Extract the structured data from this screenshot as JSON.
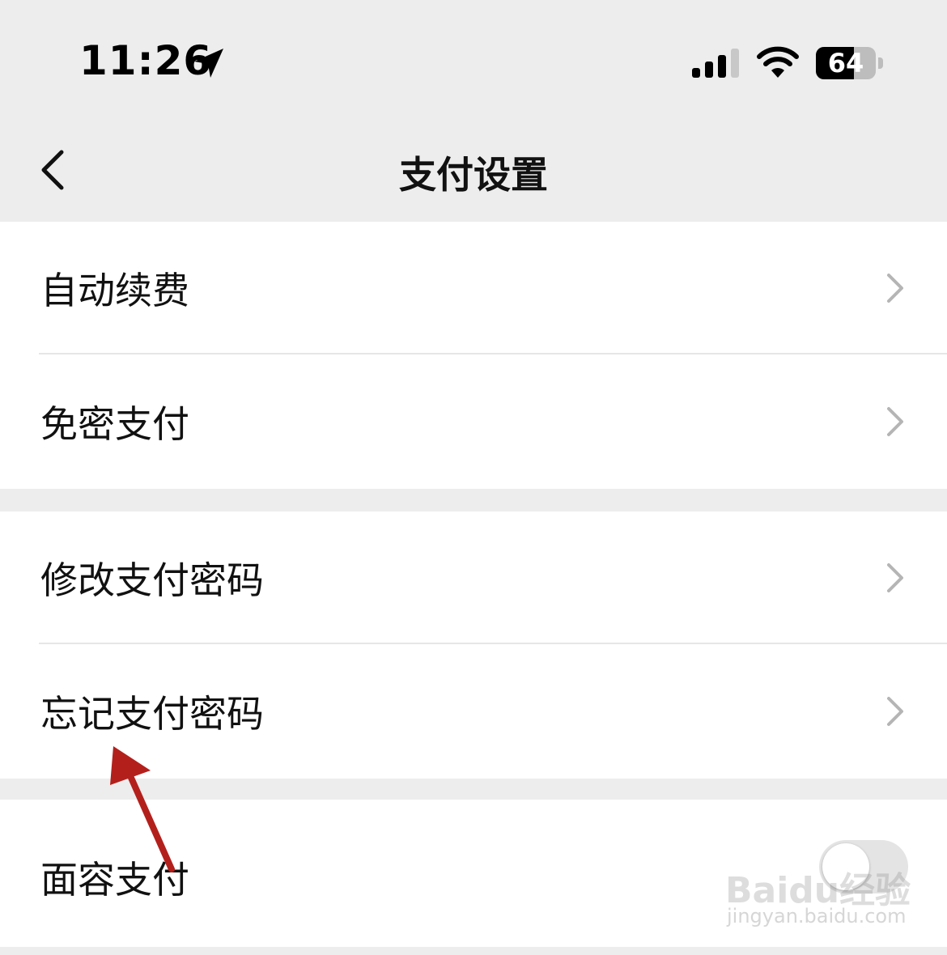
{
  "status_bar": {
    "time": "11:26",
    "battery_level": "64",
    "battery_fraction": 0.64
  },
  "nav": {
    "title": "支付设置"
  },
  "groups": [
    {
      "items": [
        {
          "label": "自动续费"
        },
        {
          "label": "免密支付"
        }
      ]
    },
    {
      "items": [
        {
          "label": "修改支付密码"
        },
        {
          "label": "忘记支付密码"
        }
      ]
    },
    {
      "items": [
        {
          "label": "面容支付",
          "toggle_on": false
        }
      ]
    }
  ],
  "annotation": {
    "color": "#b3201c"
  },
  "watermark": {
    "main": "Baidu经验",
    "sub": "jingyan.baidu.com"
  }
}
